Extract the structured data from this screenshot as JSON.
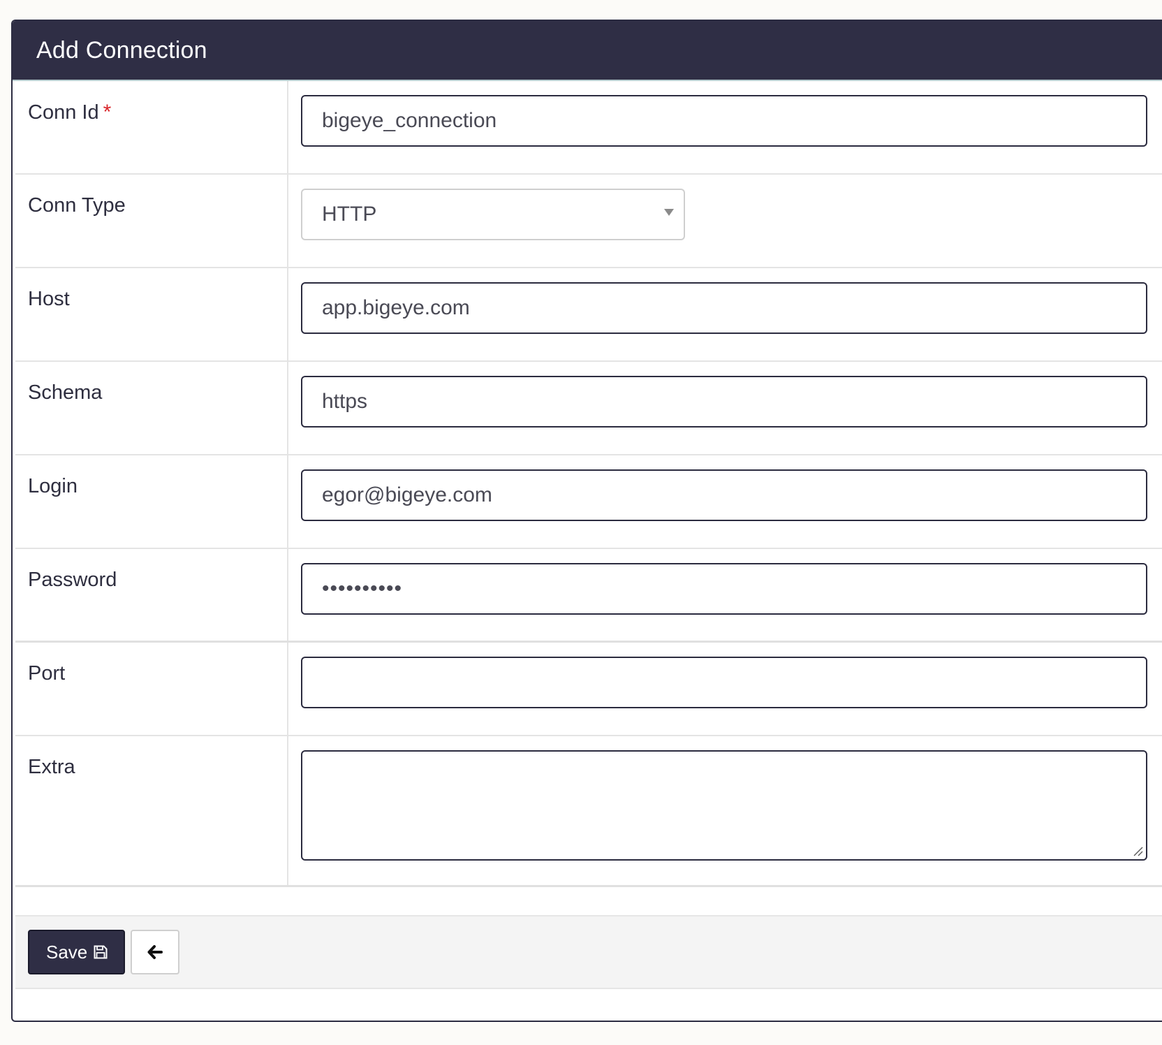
{
  "form": {
    "title": "Add Connection",
    "fields": [
      {
        "label": "Conn Id",
        "required_mark": "*",
        "value": "bigeye_connection",
        "type": "text"
      },
      {
        "label": "Conn Type",
        "value": "HTTP",
        "type": "select"
      },
      {
        "label": "Host",
        "value": "app.bigeye.com",
        "type": "text"
      },
      {
        "label": "Schema",
        "value": "https",
        "type": "text"
      },
      {
        "label": "Login",
        "value": "egor@bigeye.com",
        "type": "text"
      },
      {
        "label": "Password",
        "value": "••••••••••",
        "type": "password"
      },
      {
        "label": "Port",
        "value": "",
        "type": "text"
      },
      {
        "label": "Extra",
        "value": "",
        "type": "textarea"
      }
    ]
  },
  "actions": {
    "save_label": "Save",
    "save_icon": "floppy-disk-icon",
    "back_icon": "arrow-left-icon"
  },
  "colors": {
    "header_bg": "#2f2e45",
    "required": "#d9262b",
    "save_bg": "#2f2e45"
  }
}
